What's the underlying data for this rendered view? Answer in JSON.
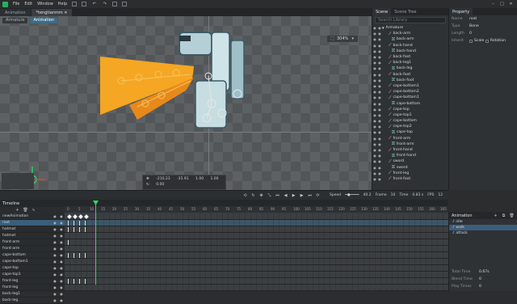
{
  "menu": {
    "items": [
      "File",
      "Edit",
      "Window",
      "Help"
    ]
  },
  "tabs": [
    {
      "label": "Animation",
      "active": false
    },
    {
      "label": "*tengtianmm",
      "active": true
    }
  ],
  "mode": {
    "armature": "Armature",
    "animation": "Animation"
  },
  "stage": {
    "zoom": "304%"
  },
  "info": {
    "x": "-210.23",
    "y": "-35.91",
    "sx": "1.00",
    "sy": "1.00",
    "rot": "0.00"
  },
  "scene_panel": {
    "tabs": [
      "Scene",
      "Scene Tree"
    ],
    "search_placeholder": "Search Library",
    "tree": [
      {
        "label": "Armature",
        "type": "root"
      },
      {
        "label": "back-arm",
        "type": "bone"
      },
      {
        "label": "back-arm",
        "type": "slot"
      },
      {
        "label": "back-hand",
        "type": "bone"
      },
      {
        "label": "back-hand",
        "type": "slot"
      },
      {
        "label": "back-foot",
        "type": "bone"
      },
      {
        "label": "back-leg1",
        "type": "bone"
      },
      {
        "label": "back-leg",
        "type": "slot"
      },
      {
        "label": "back-foot",
        "type": "bone"
      },
      {
        "label": "back-foot",
        "type": "slot"
      },
      {
        "label": "cape-bottom1",
        "type": "bone"
      },
      {
        "label": "cape-bottom2",
        "type": "bone"
      },
      {
        "label": "cape-bottom1",
        "type": "bone"
      },
      {
        "label": "cape-bottom",
        "type": "slot"
      },
      {
        "label": "cape-top",
        "type": "bone"
      },
      {
        "label": "cape-top1",
        "type": "bone"
      },
      {
        "label": "cape-bottom",
        "type": "bone"
      },
      {
        "label": "cape-top2",
        "type": "bone"
      },
      {
        "label": "cape-top",
        "type": "slot"
      },
      {
        "label": "front-arm",
        "type": "bone"
      },
      {
        "label": "front-arm",
        "type": "slot"
      },
      {
        "label": "front-hand",
        "type": "bone"
      },
      {
        "label": "front-hand",
        "type": "slot"
      },
      {
        "label": "sword",
        "type": "bone"
      },
      {
        "label": "sword",
        "type": "slot"
      },
      {
        "label": "front-leg",
        "type": "bone"
      },
      {
        "label": "front-foot",
        "type": "bone"
      }
    ]
  },
  "property": {
    "title": "Property",
    "rows": [
      {
        "k": "Name",
        "v": "root"
      },
      {
        "k": "Type",
        "v": "Bone"
      },
      {
        "k": "Length",
        "v": "0"
      }
    ],
    "inherit_label": "Inherit",
    "inherit_opts": [
      "Scale",
      "Rotation"
    ]
  },
  "toolbar2": {
    "speed_label": "Speed",
    "speed_value": "40.2",
    "frame_label": "Frame",
    "frame_value": "10",
    "time_label": "Time",
    "time_value": "0.83 s",
    "fps_label": "FPS",
    "fps_value": "12"
  },
  "timeline": {
    "title": "Timeline",
    "rows": [
      {
        "label": "newAnimation",
        "sel": false
      },
      {
        "label": "root",
        "sel": true
      },
      {
        "label": "hatmat",
        "sel": false
      },
      {
        "label": "hatmat",
        "sel": false
      },
      {
        "label": "front-arm",
        "sel": false
      },
      {
        "label": "front-arm",
        "sel": false
      },
      {
        "label": "cape-bottom",
        "sel": false
      },
      {
        "label": "cape-bottom1",
        "sel": false
      },
      {
        "label": "cape-top",
        "sel": false
      },
      {
        "label": "cape-top1",
        "sel": false
      },
      {
        "label": "front-leg",
        "sel": false
      },
      {
        "label": "front-leg",
        "sel": false
      },
      {
        "label": "back-leg1",
        "sel": false
      },
      {
        "label": "back-leg",
        "sel": false
      }
    ],
    "ruler": [
      "0",
      "5",
      "10",
      "15",
      "20",
      "25",
      "30",
      "35",
      "40",
      "45",
      "50",
      "55",
      "60",
      "65",
      "70",
      "75",
      "80",
      "85",
      "90",
      "95",
      "100",
      "105",
      "110",
      "115",
      "120",
      "125",
      "130",
      "135",
      "140",
      "145",
      "150",
      "155",
      "160",
      "165"
    ]
  },
  "anim_panel": {
    "title": "Animation",
    "items": [
      {
        "label": "idle",
        "sel": false
      },
      {
        "label": "walk",
        "sel": true
      },
      {
        "label": "attack",
        "sel": false
      }
    ],
    "foot": [
      {
        "k": "Total Time",
        "v": "0.67s"
      },
      {
        "k": "Blend Time",
        "v": "0"
      },
      {
        "k": "Play Times",
        "v": "0"
      }
    ]
  }
}
